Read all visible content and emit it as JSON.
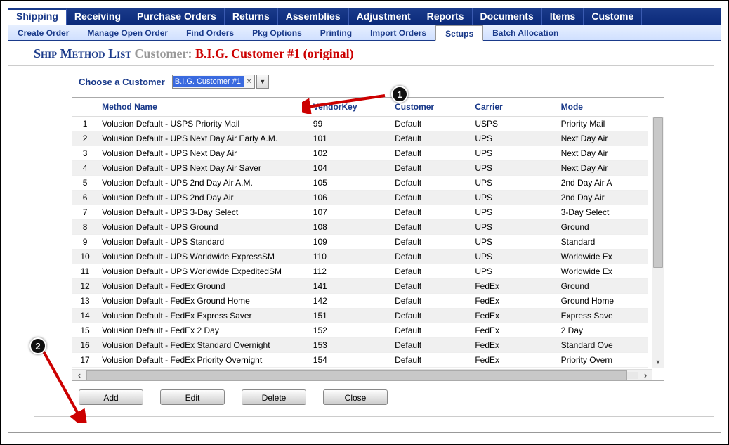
{
  "nav": {
    "main": [
      "Shipping",
      "Receiving",
      "Purchase Orders",
      "Returns",
      "Assemblies",
      "Adjustment",
      "Reports",
      "Documents",
      "Items",
      "Custome"
    ],
    "main_active_index": 0,
    "sub": [
      "Create Order",
      "Manage Open Order",
      "Find Orders",
      "Pkg Options",
      "Printing",
      "Import Orders",
      "Setups",
      "Batch Allocation"
    ],
    "sub_active_index": 6
  },
  "title": {
    "main": "Ship Method List",
    "customer_label": "Customer:",
    "customer_name": "B.I.G. Customer #1 (original)"
  },
  "filter": {
    "label": "Choose a Customer",
    "selected_text": "B.I.G. Customer #1",
    "clear_x": "×"
  },
  "table": {
    "headers": [
      "",
      "Method Name",
      "VendorKey",
      "Customer",
      "Carrier",
      "Mode"
    ],
    "rows": [
      {
        "n": 1,
        "method": "Volusion Default - USPS Priority Mail",
        "vk": "99",
        "cust": "Default",
        "carr": "USPS",
        "mode": "Priority Mail"
      },
      {
        "n": 2,
        "method": "Volusion Default - UPS Next Day Air Early A.M.",
        "vk": "101",
        "cust": "Default",
        "carr": "UPS",
        "mode": "Next Day Air"
      },
      {
        "n": 3,
        "method": "Volusion Default - UPS Next Day Air",
        "vk": "102",
        "cust": "Default",
        "carr": "UPS",
        "mode": "Next Day Air"
      },
      {
        "n": 4,
        "method": "Volusion Default - UPS Next Day Air Saver",
        "vk": "104",
        "cust": "Default",
        "carr": "UPS",
        "mode": "Next Day Air"
      },
      {
        "n": 5,
        "method": "Volusion Default - UPS 2nd Day Air A.M.",
        "vk": "105",
        "cust": "Default",
        "carr": "UPS",
        "mode": "2nd Day Air A"
      },
      {
        "n": 6,
        "method": "Volusion Default - UPS 2nd Day Air",
        "vk": "106",
        "cust": "Default",
        "carr": "UPS",
        "mode": "2nd Day Air"
      },
      {
        "n": 7,
        "method": "Volusion Default - UPS 3-Day Select",
        "vk": "107",
        "cust": "Default",
        "carr": "UPS",
        "mode": "3-Day Select"
      },
      {
        "n": 8,
        "method": "Volusion Default - UPS Ground",
        "vk": "108",
        "cust": "Default",
        "carr": "UPS",
        "mode": "Ground"
      },
      {
        "n": 9,
        "method": "Volusion Default - UPS Standard",
        "vk": "109",
        "cust": "Default",
        "carr": "UPS",
        "mode": "Standard"
      },
      {
        "n": 10,
        "method": "Volusion Default - UPS Worldwide ExpressSM",
        "vk": "110",
        "cust": "Default",
        "carr": "UPS",
        "mode": "Worldwide Ex"
      },
      {
        "n": 11,
        "method": "Volusion Default - UPS Worldwide ExpeditedSM",
        "vk": "112",
        "cust": "Default",
        "carr": "UPS",
        "mode": "Worldwide Ex"
      },
      {
        "n": 12,
        "method": "Volusion Default - FedEx Ground",
        "vk": "141",
        "cust": "Default",
        "carr": "FedEx",
        "mode": "Ground"
      },
      {
        "n": 13,
        "method": "Volusion Default - FedEx Ground Home",
        "vk": "142",
        "cust": "Default",
        "carr": "FedEx",
        "mode": "Ground Home"
      },
      {
        "n": 14,
        "method": "Volusion Default - FedEx Express Saver",
        "vk": "151",
        "cust": "Default",
        "carr": "FedEx",
        "mode": "Express Save"
      },
      {
        "n": 15,
        "method": "Volusion Default - FedEx 2 Day",
        "vk": "152",
        "cust": "Default",
        "carr": "FedEx",
        "mode": "2 Day"
      },
      {
        "n": 16,
        "method": "Volusion Default - FedEx Standard Overnight",
        "vk": "153",
        "cust": "Default",
        "carr": "FedEx",
        "mode": "Standard Ove"
      },
      {
        "n": 17,
        "method": "Volusion Default - FedEx Priority Overnight",
        "vk": "154",
        "cust": "Default",
        "carr": "FedEx",
        "mode": "Priority Overn"
      }
    ]
  },
  "buttons": {
    "add": "Add",
    "edit": "Edit",
    "delete": "Delete",
    "close": "Close"
  },
  "callouts": {
    "one": "1",
    "two": "2"
  }
}
